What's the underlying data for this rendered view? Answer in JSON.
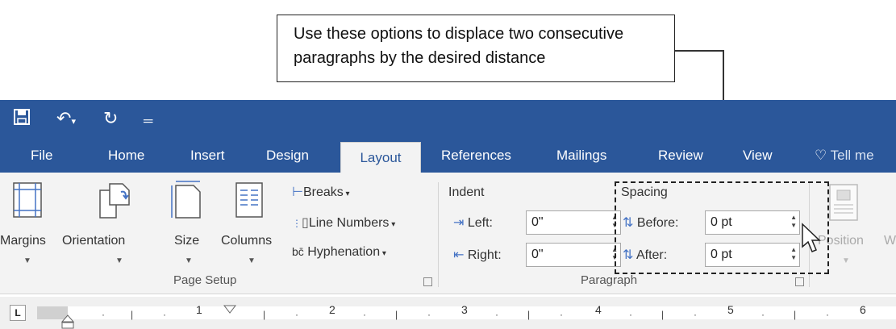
{
  "callout": {
    "line1": "Use these options to displace two consecutive",
    "line2": "paragraphs by the desired distance"
  },
  "quick_access": {
    "save_icon": "save-icon",
    "undo_icon": "undo-icon",
    "redo_icon": "redo-icon",
    "customize_icon": "customize-icon"
  },
  "tabs": [
    "File",
    "Home",
    "Insert",
    "Design",
    "Layout",
    "References",
    "Mailings",
    "Review",
    "View",
    "Tell me"
  ],
  "page_setup": {
    "margins": "Margins",
    "orientation": "Orientation",
    "size": "Size",
    "columns": "Columns",
    "breaks": "Breaks",
    "line_numbers": "Line Numbers",
    "hyphenation": "Hyphenation",
    "group_label": "Page Setup"
  },
  "paragraph": {
    "indent_title": "Indent",
    "left_label": "Left:",
    "left_value": "0\"",
    "right_label": "Right:",
    "right_value": "0\"",
    "spacing_title": "Spacing",
    "before_label": "Before:",
    "before_value": "0 pt",
    "after_label": "After:",
    "after_value": "0 pt",
    "group_label": "Paragraph"
  },
  "arrange": {
    "position": "Position"
  },
  "ruler": {
    "numbers": [
      "1",
      "2",
      "3",
      "4",
      "5",
      "6"
    ],
    "tab_marker": "L"
  }
}
